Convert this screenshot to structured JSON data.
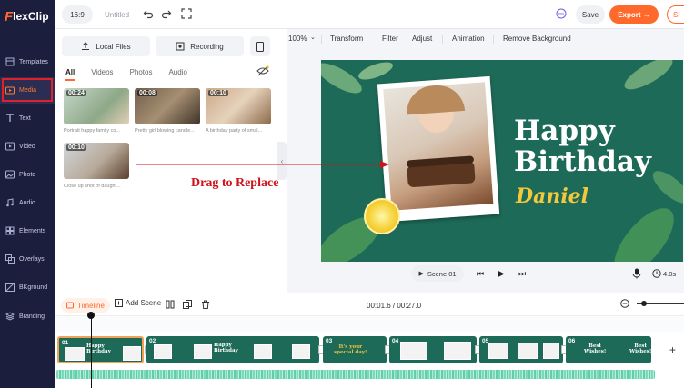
{
  "app": {
    "logo_mark": "F",
    "logo_word": "lexClip"
  },
  "topbar": {
    "aspect": "16:9",
    "title": "Untitled",
    "save_label": "Save",
    "export_label": "Export →",
    "signup_label": "Si"
  },
  "sidebar": {
    "items": [
      {
        "label": "Templates",
        "icon": "templates-icon"
      },
      {
        "label": "Media",
        "icon": "media-icon"
      },
      {
        "label": "Text",
        "icon": "text-icon"
      },
      {
        "label": "Video",
        "icon": "video-icon"
      },
      {
        "label": "Photo",
        "icon": "photo-icon"
      },
      {
        "label": "Audio",
        "icon": "audio-icon"
      },
      {
        "label": "Elements",
        "icon": "elements-icon"
      },
      {
        "label": "Overlays",
        "icon": "overlays-icon"
      },
      {
        "label": "BKground",
        "icon": "background-icon"
      },
      {
        "label": "Branding",
        "icon": "branding-icon"
      }
    ]
  },
  "media": {
    "local_files_label": "Local Files",
    "recording_label": "Recording",
    "tabs": [
      "All",
      "Videos",
      "Photos",
      "Audio"
    ],
    "thumbs": [
      {
        "duration": "00:24",
        "caption": "Portrait happy family co..."
      },
      {
        "duration": "00:08",
        "caption": "Pretty girl blowing candle..."
      },
      {
        "duration": "00:10",
        "caption": "A birthday party of smal..."
      },
      {
        "duration": "00:10",
        "caption": "Close up shot of daught..."
      }
    ]
  },
  "editbar": {
    "zoom": "100%",
    "items": [
      "Transform",
      "Filter",
      "Adjust",
      "Animation",
      "Remove Background"
    ]
  },
  "canvas": {
    "line1": "Happy",
    "line2": "Birthday",
    "name": "Daniel"
  },
  "annotation": {
    "drag_text": "Drag to Replace",
    "color": "#d0121a"
  },
  "playback": {
    "scene_label": "Scene 01",
    "duration": "4.0s"
  },
  "timeline": {
    "tab_label": "Timeline",
    "add_scene_label": "Add Scene",
    "time": "00:01.6 / 00:27.0",
    "clips": [
      {
        "num": "01",
        "text": "Happy\nBirthday"
      },
      {
        "num": "02",
        "text": "Happy\nBirthday"
      },
      {
        "num": "03",
        "text": "It's your\nspecial day!"
      },
      {
        "num": "04",
        "text": ""
      },
      {
        "num": "05",
        "text": ""
      },
      {
        "num": "06",
        "text": "Best\nWishes!"
      }
    ]
  },
  "colors": {
    "accent": "#ff6a2c",
    "sidebar": "#1c1e3d",
    "canvas_bg": "#1e6a58",
    "name_gold": "#f3c83a"
  }
}
